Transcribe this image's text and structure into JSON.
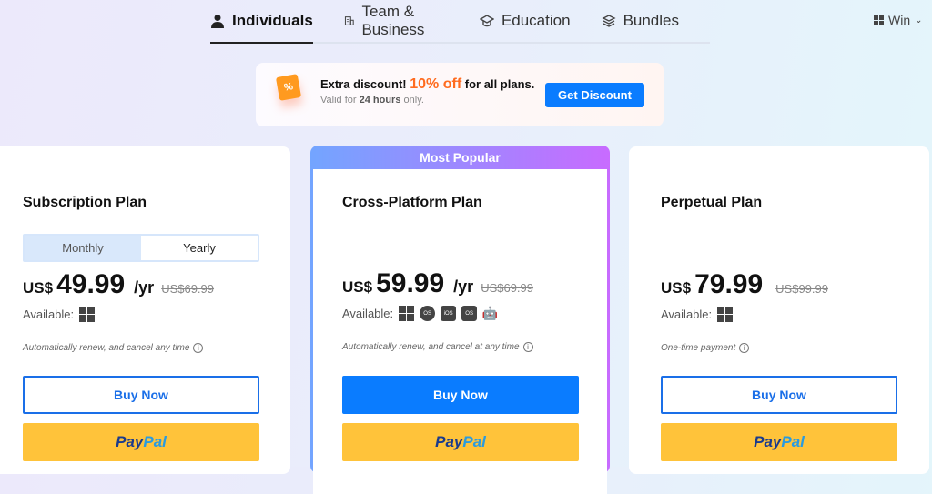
{
  "tabs": [
    {
      "label": "Individuals",
      "icon": "person-icon",
      "active": true
    },
    {
      "label": "Team & Business",
      "icon": "building-icon"
    },
    {
      "label": "Education",
      "icon": "graduation-cap-icon"
    },
    {
      "label": "Bundles",
      "icon": "layers-icon"
    }
  ],
  "os_selector": {
    "label": "Win",
    "icon": "windows-icon"
  },
  "promo": {
    "tag": "%",
    "text_prefix": "Extra discount!",
    "highlight": "10% off",
    "text_suffix": "for all plans.",
    "valid_prefix": "Valid for",
    "valid_bold": "24 hours",
    "valid_suffix": "only.",
    "button": "Get Discount"
  },
  "plans": [
    {
      "title": "Subscription Plan",
      "toggle": [
        "Monthly",
        "Yearly"
      ],
      "currency": "US$",
      "price": "49.99",
      "period": "/yr",
      "old_price": "US$69.99",
      "available_label": "Available:",
      "note": "Automatically renew, and cancel any time",
      "buy": "Buy Now",
      "paypal": [
        "Pay",
        "Pal"
      ]
    },
    {
      "badge": "Most Popular",
      "title": "Cross-Platform Plan",
      "currency": "US$",
      "price": "59.99",
      "period": "/yr",
      "old_price": "US$69.99",
      "available_label": "Available:",
      "platforms": [
        "Windows",
        "macOS",
        "iOS",
        "iPadOS",
        "Android"
      ],
      "note": "Automatically renew, and cancel at any time",
      "buy": "Buy Now",
      "paypal": [
        "Pay",
        "Pal"
      ]
    },
    {
      "title": "Perpetual Plan",
      "currency": "US$",
      "price": "79.99",
      "old_price": "US$99.99",
      "available_label": "Available:",
      "note": "One-time payment",
      "buy": "Buy Now",
      "paypal": [
        "Pay",
        "Pal"
      ]
    }
  ],
  "colors": {
    "primary": "#0a7cff",
    "paypal": "#ffc33a",
    "promo_highlight": "#ff6b1f"
  }
}
